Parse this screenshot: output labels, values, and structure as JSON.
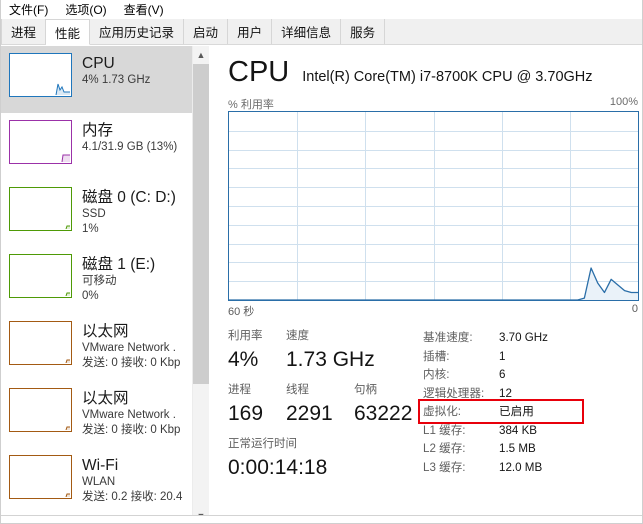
{
  "menubar": {
    "items": [
      {
        "label": "文件(F)",
        "name": "menu-file"
      },
      {
        "label": "选项(O)",
        "name": "menu-options"
      },
      {
        "label": "查看(V)",
        "name": "menu-view"
      }
    ]
  },
  "tabs": [
    {
      "label": "进程",
      "active": false
    },
    {
      "label": "性能",
      "active": true
    },
    {
      "label": "应用历史记录",
      "active": false
    },
    {
      "label": "启动",
      "active": false
    },
    {
      "label": "用户",
      "active": false
    },
    {
      "label": "详细信息",
      "active": false
    },
    {
      "label": "服务",
      "active": false
    }
  ],
  "sidebar": {
    "scroll": {
      "up_icon": "chevron-up-icon",
      "down_icon": "chevron-down-icon"
    },
    "items": [
      {
        "name": "sidebar-item-cpu",
        "title": "CPU",
        "sub1": "4% 1.73 GHz",
        "sub2": "",
        "color": "#1f76bc",
        "selected": true
      },
      {
        "name": "sidebar-item-memory",
        "title": "内存",
        "sub1": "4.1/31.9 GB (13%)",
        "sub2": "",
        "color": "#9b31a8",
        "selected": false
      },
      {
        "name": "sidebar-item-disk-0",
        "title": "磁盘 0 (C: D:)",
        "sub1": "SSD",
        "sub2": "1%",
        "color": "#4e9a06",
        "selected": false
      },
      {
        "name": "sidebar-item-disk-1",
        "title": "磁盘 1 (E:)",
        "sub1": "可移动",
        "sub2": "0%",
        "color": "#4e9a06",
        "selected": false
      },
      {
        "name": "sidebar-item-ethernet-1",
        "title": "以太网",
        "sub1": "VMware Network .",
        "sub2": "发送: 0 接收: 0 Kbp",
        "color": "#a35a13",
        "selected": false
      },
      {
        "name": "sidebar-item-ethernet-2",
        "title": "以太网",
        "sub1": "VMware Network .",
        "sub2": "发送: 0 接收: 0 Kbp",
        "color": "#a35a13",
        "selected": false
      },
      {
        "name": "sidebar-item-wifi",
        "title": "Wi-Fi",
        "sub1": "WLAN",
        "sub2": "发送: 0.2 接收: 20.4",
        "color": "#a35a13",
        "selected": false
      }
    ]
  },
  "detail": {
    "heading": "CPU",
    "model": "Intel(R) Core(TM) i7-8700K CPU @ 3.70GHz",
    "graph_top_label": "% 利用率",
    "graph_top_right": "100%",
    "graph_bottom_left": "60 秒",
    "graph_bottom_right": "0",
    "stats_primary": [
      {
        "label": "利用率",
        "value": "4%",
        "name": "stat-utilization"
      },
      {
        "label": "速度",
        "value": "1.73 GHz",
        "name": "stat-speed"
      }
    ],
    "stats_secondary": [
      {
        "label": "进程",
        "value": "169",
        "name": "stat-processes"
      },
      {
        "label": "线程",
        "value": "2291",
        "name": "stat-threads"
      },
      {
        "label": "句柄",
        "value": "63222",
        "name": "stat-handles"
      }
    ],
    "uptime": {
      "label": "正常运行时间",
      "value": "0:00:14:18",
      "name": "stat-uptime"
    },
    "specs": [
      {
        "key": "基准速度:",
        "value": "3.70 GHz",
        "name": "spec-base-speed"
      },
      {
        "key": "插槽:",
        "value": "1",
        "name": "spec-sockets"
      },
      {
        "key": "内核:",
        "value": "6",
        "name": "spec-cores"
      },
      {
        "key": "逻辑处理器:",
        "value": "12",
        "name": "spec-logical-processors"
      },
      {
        "key": "虚拟化:",
        "value": "已启用",
        "name": "spec-virtualization"
      },
      {
        "key": "L1 缓存:",
        "value": "384 KB",
        "name": "spec-l1-cache"
      },
      {
        "key": "L2 缓存:",
        "value": "1.5 MB",
        "name": "spec-l2-cache"
      },
      {
        "key": "L3 缓存:",
        "value": "12.0 MB",
        "name": "spec-l3-cache"
      }
    ],
    "annotation": {
      "color": "#e8000b",
      "target": "虚拟化"
    }
  },
  "chart_data": {
    "type": "area",
    "title": "% 利用率",
    "xlabel": "",
    "ylabel": "% 利用率",
    "ylim": [
      0,
      100
    ],
    "xlim": [
      60,
      0
    ],
    "x_tick_labels": [
      "60 秒",
      "0"
    ],
    "y_tick_labels": [
      "100%"
    ],
    "grid": true,
    "grid_cols": 6,
    "grid_rows": 10,
    "line_color": "#2a6ea8",
    "fill_color": "#eaf2f9",
    "series": [
      {
        "name": "CPU 利用率",
        "values": [
          0,
          0,
          0,
          0,
          0,
          0,
          0,
          0,
          0,
          0,
          0,
          0,
          0,
          0,
          0,
          0,
          0,
          0,
          0,
          0,
          0,
          0,
          0,
          0,
          0,
          0,
          0,
          0,
          0,
          0,
          0,
          0,
          0,
          0,
          0,
          0,
          0,
          0,
          0,
          0,
          0,
          0,
          0,
          0,
          0,
          0,
          0,
          0,
          0,
          0,
          0,
          0,
          0,
          1,
          17,
          9,
          4,
          11,
          8,
          5,
          4,
          4
        ]
      }
    ]
  }
}
